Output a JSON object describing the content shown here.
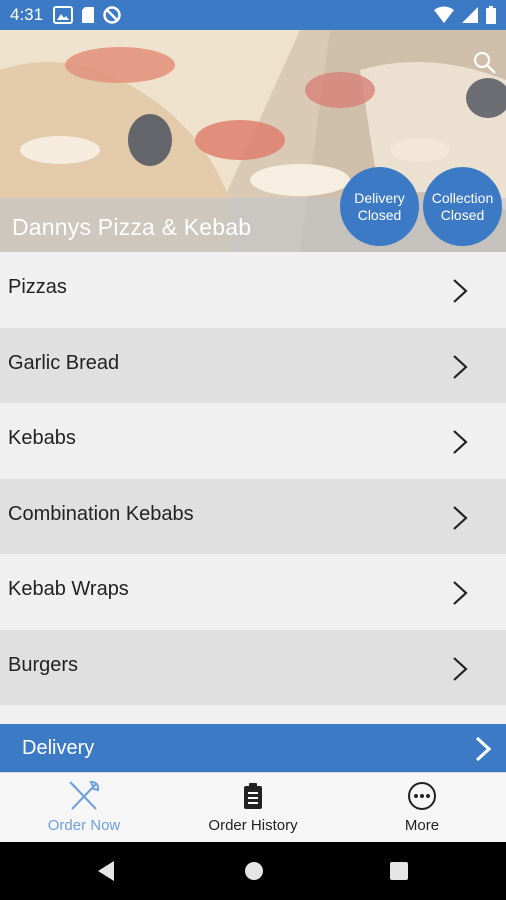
{
  "status_bar": {
    "time": "4:31",
    "icons_left": [
      "gallery-icon",
      "sd-card-icon",
      "do-not-disturb-icon"
    ],
    "icons_right": [
      "wifi-icon",
      "signal-icon",
      "battery-icon"
    ]
  },
  "store": {
    "name": "Dannys Pizza & Kebab",
    "delivery_status": [
      "Delivery",
      "Closed"
    ],
    "collection_status": [
      "Collection",
      "Closed"
    ]
  },
  "menu": {
    "items": [
      {
        "label": "Pizzas"
      },
      {
        "label": "Garlic Bread"
      },
      {
        "label": "Kebabs"
      },
      {
        "label": "Combination Kebabs"
      },
      {
        "label": "Kebab Wraps"
      },
      {
        "label": "Burgers"
      }
    ]
  },
  "delivery_bar": {
    "label": "Delivery"
  },
  "bottom_nav": {
    "order_now": "Order Now",
    "order_history": "Order History",
    "more": "More"
  },
  "colors": {
    "primary": "#3d7ac6",
    "active_tab": "#6ea0dc",
    "row_light": "#f0f0f0",
    "row_dark": "#e0e0e0"
  }
}
